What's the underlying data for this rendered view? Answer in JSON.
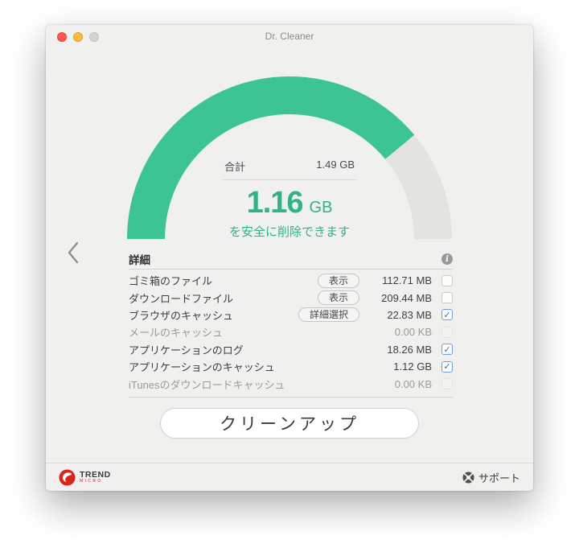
{
  "window": {
    "title": "Dr. Cleaner"
  },
  "nav": {
    "back_tooltip": "back"
  },
  "gauge": {
    "total_label": "合計",
    "total_value": "1.49 GB",
    "cleanable_value": "1.16",
    "cleanable_unit": "GB",
    "subtitle": "を安全に削除できます",
    "arc_color": "#3cc493",
    "track_color": "#e3e3e1",
    "text_color": "#32b287"
  },
  "chart_data": {
    "type": "gauge",
    "title": "cleanable disk space",
    "total_gb": 1.49,
    "cleanable_gb": 1.16,
    "percent_filled": 0.778,
    "arc_span_degrees": 180
  },
  "details": {
    "header": "詳細",
    "rows": [
      {
        "label": "ゴミ箱のファイル",
        "button": "表示",
        "value": "112.71 MB",
        "checked": false,
        "disabled": false
      },
      {
        "label": "ダウンロードファイル",
        "button": "表示",
        "value": "209.44 MB",
        "checked": false,
        "disabled": false
      },
      {
        "label": "ブラウザのキャッシュ",
        "button": "詳細選択",
        "value": "22.83 MB",
        "checked": true,
        "disabled": false
      },
      {
        "label": "メールのキャッシュ",
        "button": null,
        "value": "0.00 KB",
        "checked": false,
        "disabled": true
      },
      {
        "label": "アプリケーションのログ",
        "button": null,
        "value": "18.26 MB",
        "checked": true,
        "disabled": false
      },
      {
        "label": "アプリケーションのキャッシュ",
        "button": null,
        "value": "1.12 GB",
        "checked": true,
        "disabled": false
      },
      {
        "label": "iTunesのダウンロードキャッシュ",
        "button": null,
        "value": "0.00 KB",
        "checked": false,
        "disabled": true
      }
    ]
  },
  "cleanup_button_label": "クリーンアップ",
  "footer": {
    "brand_line1": "TREND",
    "brand_line2": "MICRO",
    "brand_red": "#d8261f",
    "support_label": "サポート"
  }
}
